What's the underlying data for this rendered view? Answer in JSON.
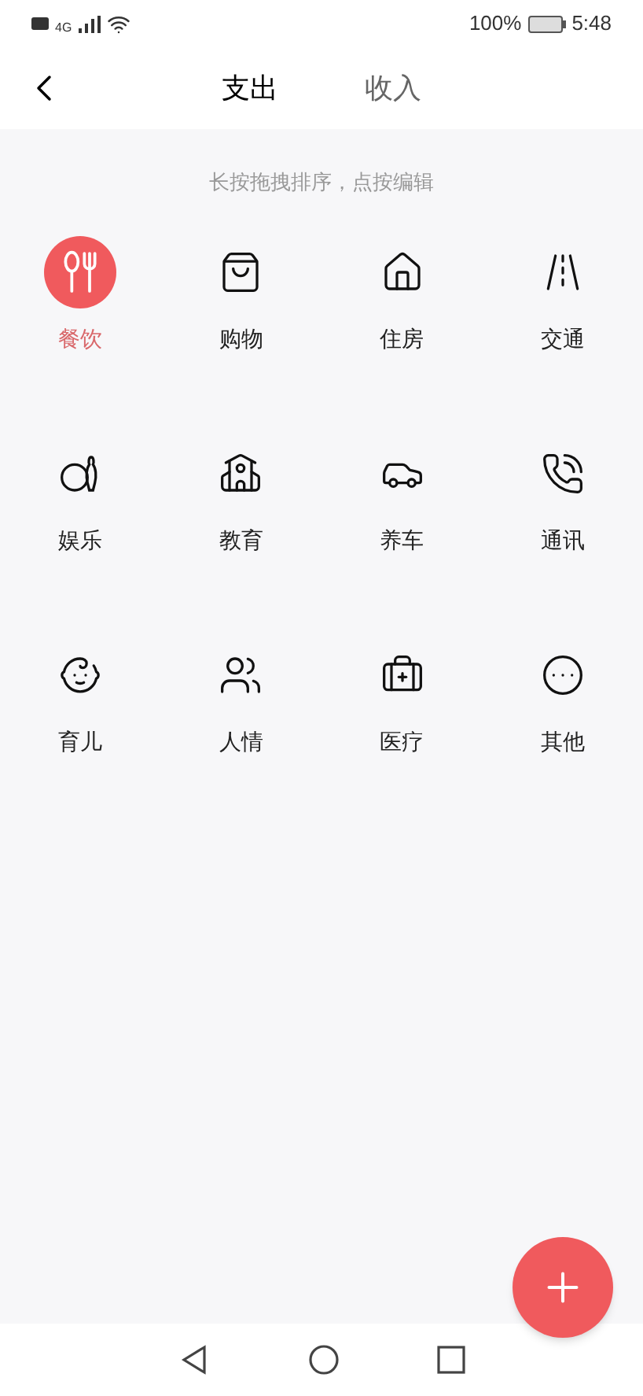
{
  "status_bar": {
    "network": "4G",
    "battery": "100%",
    "time": "5:48"
  },
  "tabs": [
    {
      "label": "支出",
      "selected": true
    },
    {
      "label": "收入",
      "selected": false
    }
  ],
  "hint": "长按拖拽排序，点按编辑",
  "categories": [
    {
      "label": "餐饮",
      "selected": true
    },
    {
      "label": "购物",
      "selected": false
    },
    {
      "label": "住房",
      "selected": false
    },
    {
      "label": "交通",
      "selected": false
    },
    {
      "label": "娱乐",
      "selected": false
    },
    {
      "label": "教育",
      "selected": false
    },
    {
      "label": "养车",
      "selected": false
    },
    {
      "label": "通讯",
      "selected": false
    },
    {
      "label": "育儿",
      "selected": false
    },
    {
      "label": "人情",
      "selected": false
    },
    {
      "label": "医疗",
      "selected": false
    },
    {
      "label": "其他",
      "selected": false
    }
  ]
}
